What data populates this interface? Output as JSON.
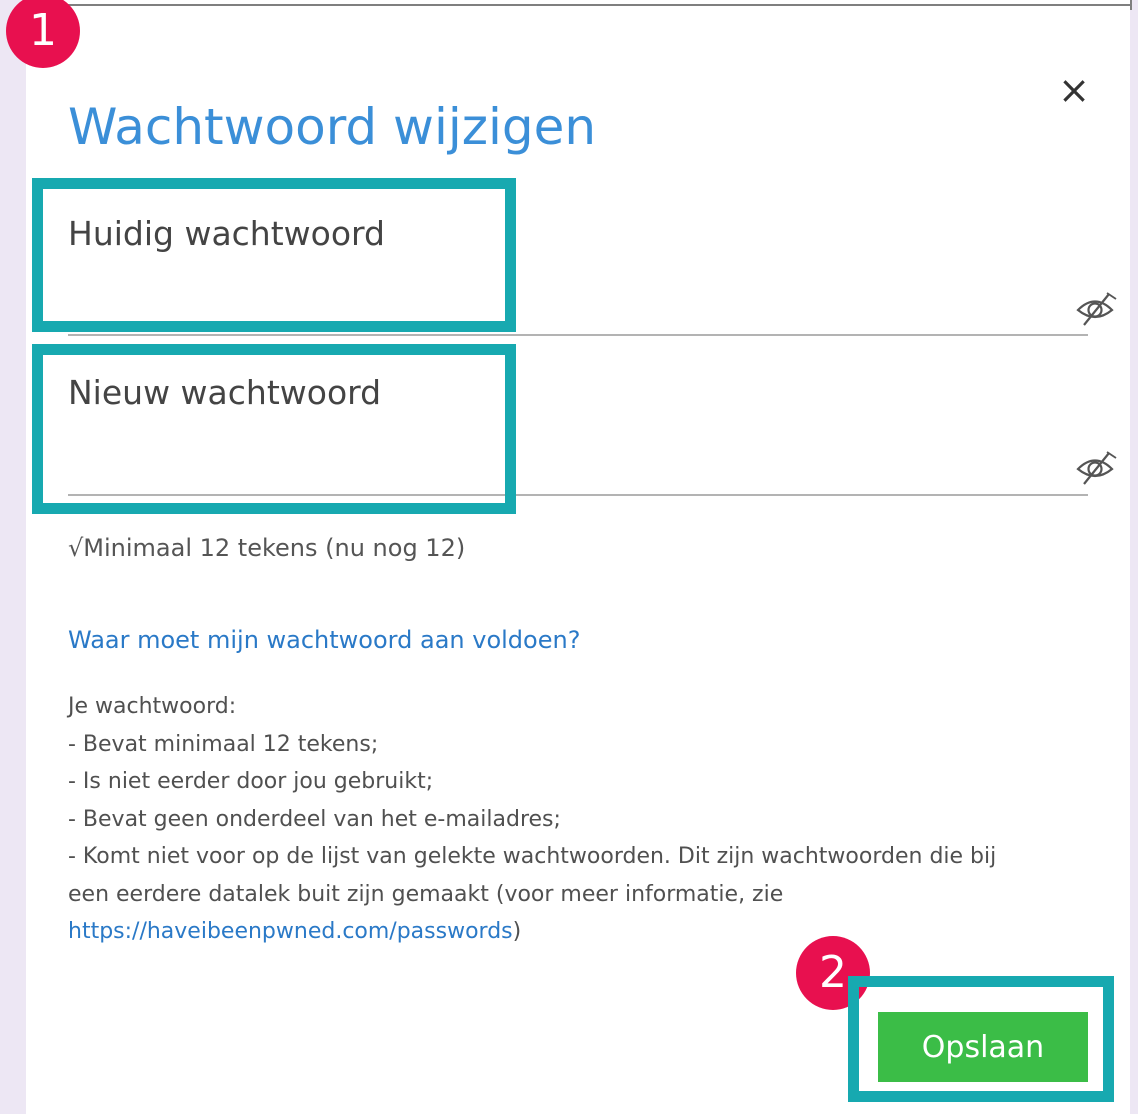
{
  "markers": {
    "step1": "1",
    "step2": "2"
  },
  "dialog": {
    "title": "Wachtwoord wijzigen",
    "close_icon": "×"
  },
  "fields": {
    "current_password": {
      "label": "Huidig wachtwoord",
      "value": "",
      "toggle_icon": "eye-slash-icon"
    },
    "new_password": {
      "label": "Nieuw wachtwoord",
      "value": "",
      "toggle_icon": "eye-slash-icon"
    }
  },
  "hint": "√Minimaal 12 tekens (nu nog 12)",
  "requirements": {
    "link": "Waar moet mijn wachtwoord aan voldoen?",
    "intro": "Je wachtwoord:",
    "rules": [
      "- Bevat minimaal 12 tekens;",
      "- Is niet eerder door jou gebruikt;",
      "- Bevat geen onderdeel van het e-mailadres;",
      "- Komt niet voor op de lijst van gelekte wachtwoorden. Dit zijn wachtwoorden die bij",
      "een eerdere datalek buit zijn gemaakt (voor meer informatie, zie"
    ],
    "url": "https://haveibeenpwned.com/passwords",
    "url_suffix": ")"
  },
  "save_button": "Opslaan",
  "colors": {
    "title": "#3b8fd8",
    "link": "#2a79c7",
    "save_button": "#3bbd47",
    "highlight": "#17a9b0",
    "marker": "#e8104f"
  }
}
